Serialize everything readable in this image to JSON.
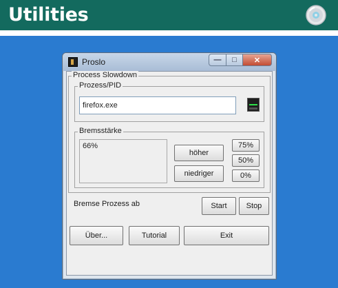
{
  "header": {
    "title": "Utilities",
    "icon": "cd-icon"
  },
  "window": {
    "title": "Proslo",
    "group_main": "Process Slowdown",
    "group_pid": "Prozess/PID",
    "process_value": "firefox.exe",
    "group_brake": "Bremsstärke",
    "brake_value": "66%",
    "btn_higher": "höher",
    "btn_lower": "niedriger",
    "btn_75": "75%",
    "btn_50": "50%",
    "btn_0": "0%",
    "status_text": "Bremse Prozess ab",
    "btn_start": "Start",
    "btn_stop": "Stop",
    "btn_about": "Über...",
    "btn_tutorial": "Tutorial",
    "btn_exit": "Exit"
  },
  "colors": {
    "header_bg": "#136a5e",
    "desktop_bg": "#2a7bd0",
    "close_btn": "#c24c33"
  }
}
